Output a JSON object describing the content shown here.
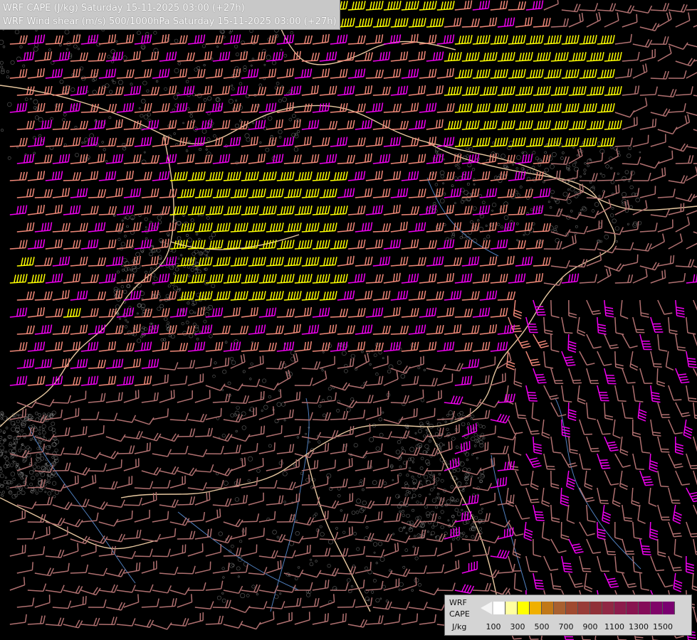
{
  "header": {
    "line1": "WRF CAPE (J/kg) Saturday 15-11-2025 03:00 (+27h)",
    "line2": "WRF Wind shear (m/s) 500/1000hPa Saturday 15-11-2025 03:00 (+27h)"
  },
  "legend": {
    "label_line1": "WRF",
    "label_line2": "CAPE",
    "unit": "J/kg",
    "colors": [
      "#ffffff",
      "#ffffa0",
      "#ffff00",
      "#f0b000",
      "#c07818",
      "#a86030",
      "#a04a30",
      "#983c38",
      "#903038",
      "#902844",
      "#8c1c4c",
      "#881450",
      "#840c58",
      "#800468",
      "#7a0070"
    ],
    "tick_labels": [
      "100",
      "300",
      "500",
      "700",
      "900",
      "1100",
      "1300",
      "1500"
    ]
  },
  "map": {
    "background": "#000000",
    "barb_colors": {
      "weak": "#b07070",
      "moderate": "#f08878",
      "strong": "#f000f0",
      "very_strong": "#ffff00"
    },
    "border_color": "#e8c8a0",
    "river_color": "#5080c0",
    "terrain_color": "#a0a0a0"
  }
}
